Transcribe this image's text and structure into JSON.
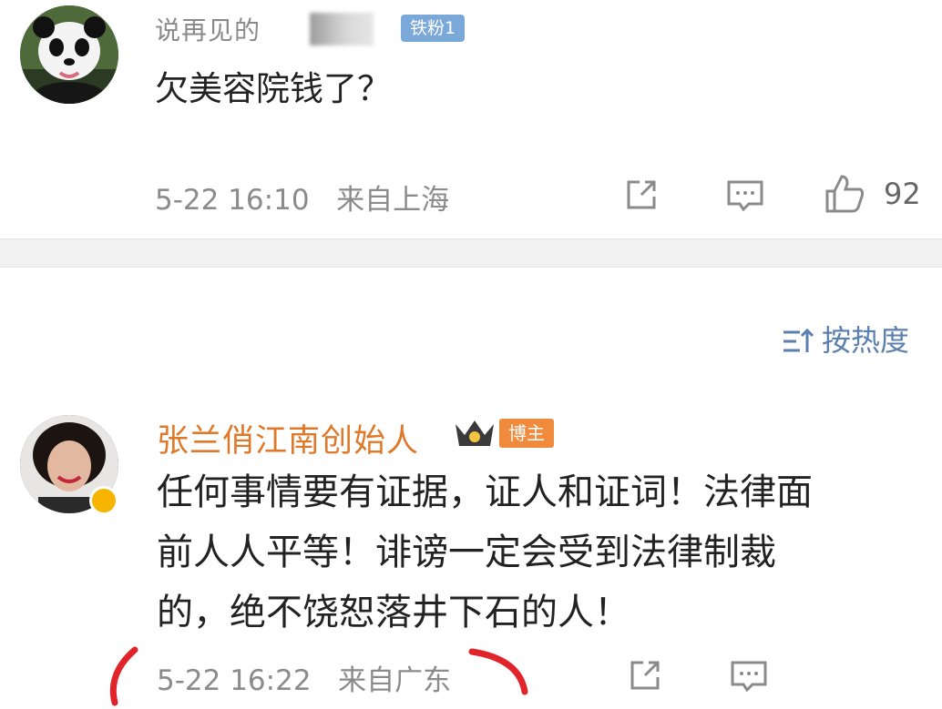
{
  "comment1": {
    "username": "说再见的",
    "fan_badge": "铁粉1",
    "text": "欠美容院钱了？",
    "timestamp": "5-22 16:10",
    "location": "来自上海",
    "like_count": "92"
  },
  "sort": {
    "label": "按热度"
  },
  "comment2": {
    "username": "张兰俏江南创始人",
    "badge": "博主",
    "text_lines": [
      "任何事情要有证据，证人和证词！法律面",
      "前人人平等！诽谤一定会受到法律制裁",
      "的，绝不饶恕落井下石的人！"
    ],
    "timestamp": "5-22 16:22",
    "location": "来自广东"
  },
  "colors": {
    "blogger_name": "#e0782a",
    "fan_badge_bg": "#79a8d9",
    "blogger_badge_bg": "#f08a3c",
    "sort_link": "#5b7fae",
    "meta_text": "#8b8b8b",
    "annotation_red": "#e0242a"
  }
}
